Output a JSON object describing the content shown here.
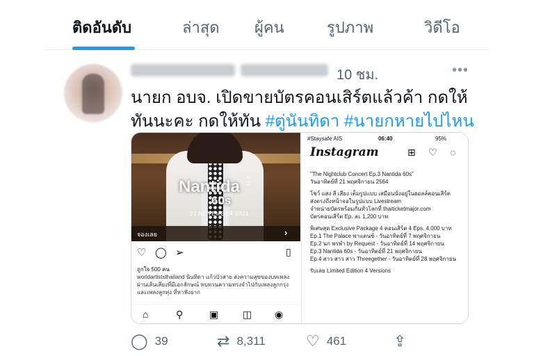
{
  "tabs": [
    "ติดอันดับ",
    "ล่าสุด",
    "ผู้คน",
    "รูปภาพ",
    "วิดีโอ"
  ],
  "tweet": {
    "time": "10 ชม.",
    "more_icon": "more-icon",
    "line1": "นายก อบจ. เปิดขายบัตรคอนเสิร์ตแล้วค้า กดให้",
    "line2_text": "ทันนะคะ กดให้ทัน ",
    "hashtag1": "#ตู่นันทิดา",
    "hashtag2": "#นายกหายไปไหน"
  },
  "media": {
    "left": {
      "ep_label": "Ep.3",
      "brand": "Nantida",
      "brand_sub": "60s",
      "date": "21 NOVEMBER 2021",
      "book_label": "จองเลย",
      "likes": "ถูกใจ 500 คน",
      "caption": "worldartiststhailand นันทิดา แก้วบัวสาย ส่งความสุขของบทเพลง ผ่านเส้นเสียงที่มีเอกลักษณ์ ทบทวนความทรงจำไปกับเพลงลูกกรุง และเพลงลูกทุ่ง ที่หาฟังยาก"
    },
    "right": {
      "status_left": "#Staysafe AIS",
      "status_time": "06:40",
      "status_right": "95%",
      "logo": "Instagram",
      "paragraphs": [
        "\"The Nightclub Concert Ep.3 Nantida 60s\"\nวันอาทิตย์ที่ 21 พฤศจิกายน 2564",
        "โชว์ แสง สี เสียง เต็มรูปแบบ เสมือนนั่งอยู่ในฮอลล์คอนเสิร์ต\nส่งตรงถึงหน้าจอในรูปแบบ Livestream\nจำหน่ายบัตรพร้อมกันทั่วโลกที่ thaiticketmajor.com\nบัตรคอนเสิร์ต Ep. ละ 1,200 บาท",
        "พิเศษสุด Exclusive Package 4 คอนเสิร์ต 4 Eps. 4,000 บาท\nEp.1 The Palace พาแดนซ์ - วันอาทิตย์ที่ 7 พฤศจิกายน\nEp.2 นก พรพำ by Request - วันอาทิตย์ที่ 14 พฤศจิกายน\nEp.3 Nantida 60s - วันอาทิตย์ที่ 21 พฤศจิกายน\nEp.4 สาว สาว สาว Threegether - วันอาทิตย์ที่ 28 พฤศจิกายน",
        "รับเลย Limited Edition 4 Versions"
      ]
    }
  },
  "actions": {
    "replies": "39",
    "retweets": "8,311",
    "likes": "461"
  },
  "colors": {
    "accent": "#1d9bf0",
    "text": "#0f1419",
    "muted": "#536471"
  }
}
